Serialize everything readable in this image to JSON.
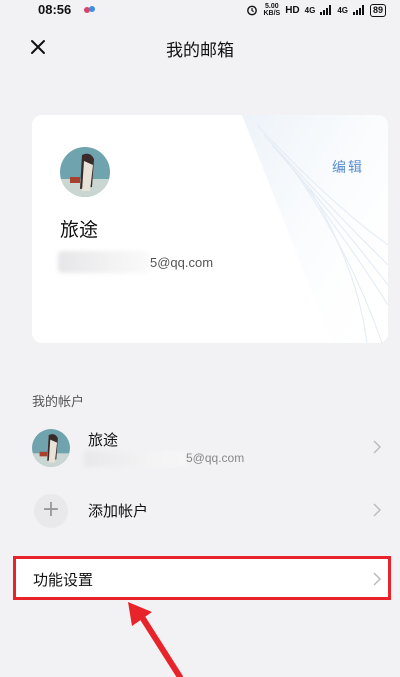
{
  "status_bar": {
    "time": "08:56",
    "net_speed_value": "5.00",
    "net_speed_unit": "KB/S",
    "hd_label": "HD",
    "signal_1": "4G",
    "signal_2": "4G",
    "battery": "89"
  },
  "header": {
    "title": "我的邮箱",
    "close_icon": "close-icon"
  },
  "profile": {
    "name": "旅途",
    "email_visible": "5@qq.com",
    "edit_label": "编辑"
  },
  "accounts_section": {
    "label": "我的帐户",
    "accounts": [
      {
        "name": "旅途",
        "email_visible": "5@qq.com"
      }
    ],
    "add_account_label": "添加帐户",
    "add_icon": "plus-icon"
  },
  "settings": {
    "label": "功能设置",
    "highlight_color": "#e8232a"
  },
  "colors": {
    "background": "#f2f2f4",
    "card": "#ffffff",
    "link": "#5a8fd0",
    "annotation": "#e8232a"
  }
}
